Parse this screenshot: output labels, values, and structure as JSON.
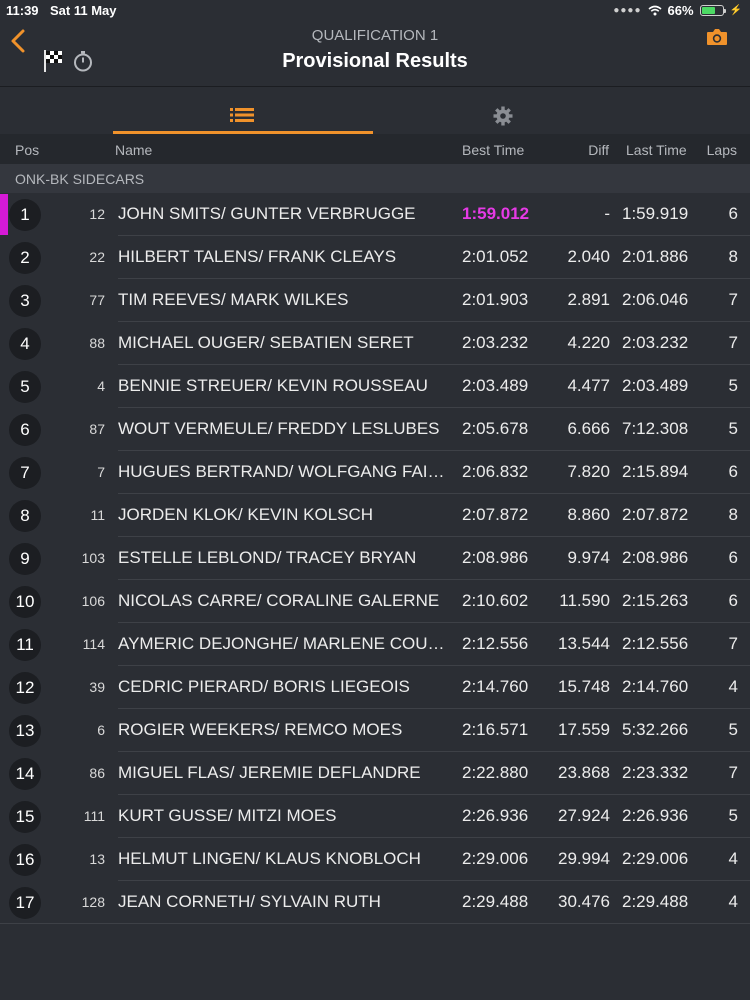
{
  "status_bar": {
    "time": "11:39",
    "date": "Sat 11 May",
    "battery": "66%",
    "battery_level": 0.66
  },
  "header": {
    "session": "QUALIFICATION 1",
    "title": "Provisional Results",
    "back_icon": "chevron-left-icon",
    "camera_icon": "camera-icon",
    "accent_color": "#f0922b"
  },
  "tabs": [
    {
      "icon": "list-icon",
      "selected": true
    },
    {
      "icon": "gear-icon",
      "selected": false
    }
  ],
  "columns": {
    "pos": "Pos",
    "name": "Name",
    "best": "Best Time",
    "diff": "Diff",
    "last": "Last Time",
    "laps": "Laps"
  },
  "class_name": "ONK-BK SIDECARS",
  "fastest_color": "#e63ae6",
  "rows": [
    {
      "pos": "1",
      "num": "12",
      "name": "JOHN SMITS/ GUNTER VERBRUGGE",
      "best": "1:59.012",
      "diff": "-",
      "last": "1:59.919",
      "laps": "6"
    },
    {
      "pos": "2",
      "num": "22",
      "name": "HILBERT TALENS/ FRANK CLEAYS",
      "best": "2:01.052",
      "diff": "2.040",
      "last": "2:01.886",
      "laps": "8"
    },
    {
      "pos": "3",
      "num": "77",
      "name": "TIM REEVES/ MARK WILKES",
      "best": "2:01.903",
      "diff": "2.891",
      "last": "2:06.046",
      "laps": "7"
    },
    {
      "pos": "4",
      "num": "88",
      "name": "MICHAEL OUGER/ SEBATIEN SERET",
      "best": "2:03.232",
      "diff": "4.220",
      "last": "2:03.232",
      "laps": "7"
    },
    {
      "pos": "5",
      "num": "4",
      "name": "BENNIE STREUER/ KEVIN ROUSSEAU",
      "best": "2:03.489",
      "diff": "4.477",
      "last": "2:03.489",
      "laps": "5"
    },
    {
      "pos": "6",
      "num": "87",
      "name": "WOUT VERMEULE/ FREDDY LESLUBES",
      "best": "2:05.678",
      "diff": "6.666",
      "last": "7:12.308",
      "laps": "5"
    },
    {
      "pos": "7",
      "num": "7",
      "name": "HUGUES BERTRAND/ WOLFGANG FAI…",
      "best": "2:06.832",
      "diff": "7.820",
      "last": "2:15.894",
      "laps": "6"
    },
    {
      "pos": "8",
      "num": "11",
      "name": "JORDEN KLOK/ KEVIN KOLSCH",
      "best": "2:07.872",
      "diff": "8.860",
      "last": "2:07.872",
      "laps": "8"
    },
    {
      "pos": "9",
      "num": "103",
      "name": "ESTELLE LEBLOND/ TRACEY BRYAN",
      "best": "2:08.986",
      "diff": "9.974",
      "last": "2:08.986",
      "laps": "6"
    },
    {
      "pos": "10",
      "num": "106",
      "name": "NICOLAS CARRE/ CORALINE GALERNE",
      "best": "2:10.602",
      "diff": "11.590",
      "last": "2:15.263",
      "laps": "6"
    },
    {
      "pos": "11",
      "num": "114",
      "name": "AYMERIC DEJONGHE/ MARLENE COU…",
      "best": "2:12.556",
      "diff": "13.544",
      "last": "2:12.556",
      "laps": "7"
    },
    {
      "pos": "12",
      "num": "39",
      "name": "CEDRIC PIERARD/ BORIS LIEGEOIS",
      "best": "2:14.760",
      "diff": "15.748",
      "last": "2:14.760",
      "laps": "4"
    },
    {
      "pos": "13",
      "num": "6",
      "name": "ROGIER WEEKERS/ REMCO MOES",
      "best": "2:16.571",
      "diff": "17.559",
      "last": "5:32.266",
      "laps": "5"
    },
    {
      "pos": "14",
      "num": "86",
      "name": "MIGUEL FLAS/ JEREMIE DEFLANDRE",
      "best": "2:22.880",
      "diff": "23.868",
      "last": "2:23.332",
      "laps": "7"
    },
    {
      "pos": "15",
      "num": "111",
      "name": "KURT GUSSE/ MITZI MOES",
      "best": "2:26.936",
      "diff": "27.924",
      "last": "2:26.936",
      "laps": "5"
    },
    {
      "pos": "16",
      "num": "13",
      "name": "HELMUT LINGEN/ KLAUS KNOBLOCH",
      "best": "2:29.006",
      "diff": "29.994",
      "last": "2:29.006",
      "laps": "4"
    },
    {
      "pos": "17",
      "num": "128",
      "name": "JEAN CORNETH/ SYLVAIN RUTH",
      "best": "2:29.488",
      "diff": "30.476",
      "last": "2:29.488",
      "laps": "4"
    }
  ]
}
